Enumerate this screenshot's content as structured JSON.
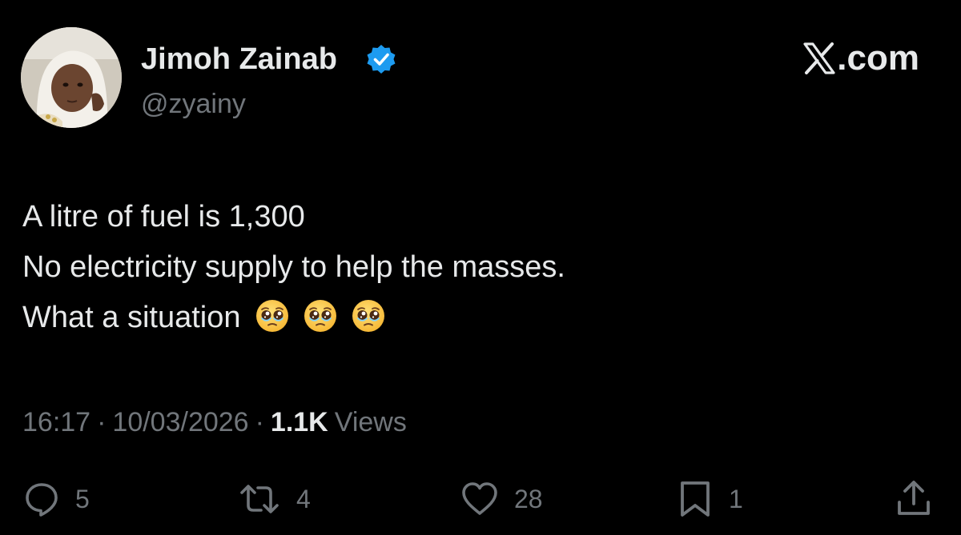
{
  "author": {
    "display_name": "Jimoh Zainab",
    "handle": "@zyainy",
    "verified": true
  },
  "brand": {
    "text": ".com",
    "logo": "x-logo-icon"
  },
  "tweet": {
    "lines": [
      "A litre of fuel is 1,300",
      "No electricity supply to help the masses.",
      "What a situation"
    ],
    "emojis": [
      "pleading-face",
      "pleading-face",
      "pleading-face"
    ]
  },
  "meta": {
    "time": "16:17",
    "separator": "·",
    "date": "10/03/2026",
    "views_count": "1.1K",
    "views_label": "Views"
  },
  "actions": {
    "replies": "5",
    "reposts": "4",
    "likes": "28",
    "bookmarks": "1"
  },
  "colors": {
    "background": "#000000",
    "primary_text": "#e7e9ea",
    "secondary_text": "#71767b",
    "verified_blue": "#1d9bf0"
  }
}
